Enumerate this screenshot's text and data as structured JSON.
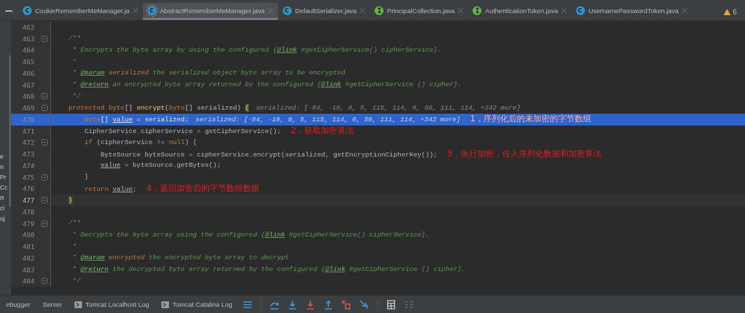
{
  "tabs": [
    {
      "label": "CookieRememberMeManager.ja",
      "kind": "class",
      "selected": false
    },
    {
      "label": "AbstractRememberMeManager.java",
      "kind": "abstract",
      "selected": true
    },
    {
      "label": "DefaultSerializer.java",
      "kind": "class",
      "selected": false
    },
    {
      "label": "PrincipalCollection.java",
      "kind": "interface",
      "selected": false
    },
    {
      "label": "AuthenticationToken.java",
      "kind": "interface",
      "selected": false
    },
    {
      "label": "UsernamePasswordToken.java",
      "kind": "class",
      "selected": false
    }
  ],
  "warnings": "6",
  "side_panel": [
    "e",
    "n",
    "Pr",
    "Cc",
    "rt",
    "ci",
    "oj"
  ],
  "lines": [
    {
      "number": "462",
      "selected": false,
      "caret": false
    },
    {
      "number": "463",
      "selected": false,
      "caret": false,
      "fold": true,
      "tokens": [
        {
          "text": "    /**",
          "kind": "comment"
        }
      ]
    },
    {
      "number": "464",
      "selected": false,
      "caret": false,
      "tokens": [
        {
          "text": "     * Encrypts the byte array by using the configured {",
          "kind": "comment"
        },
        {
          "text": "@link",
          "kind": "tag"
        },
        {
          "text": " #getCipherService() cipherService}.",
          "kind": "comment"
        }
      ]
    },
    {
      "number": "465",
      "selected": false,
      "caret": false,
      "tokens": [
        {
          "text": "     *",
          "kind": "comment"
        }
      ]
    },
    {
      "number": "466",
      "selected": false,
      "caret": false,
      "tokens": [
        {
          "text": "     * ",
          "kind": "comment"
        },
        {
          "text": "@param",
          "kind": "tag"
        },
        {
          "text": " serialized",
          "kind": "param"
        },
        {
          "text": " the serialized object byte array to be encrypted",
          "kind": "comment"
        }
      ]
    },
    {
      "number": "467",
      "selected": false,
      "caret": false,
      "tokens": [
        {
          "text": "     * ",
          "kind": "comment"
        },
        {
          "text": "@return",
          "kind": "tag"
        },
        {
          "text": " an encrypted byte array returned by the configured {",
          "kind": "comment"
        },
        {
          "text": "@link",
          "kind": "tag"
        },
        {
          "text": " #getCipherService () cipher}.",
          "kind": "comment"
        }
      ]
    },
    {
      "number": "468",
      "selected": false,
      "caret": false,
      "fold": true,
      "tokens": [
        {
          "text": "     */",
          "kind": "comment"
        }
      ]
    },
    {
      "number": "469",
      "selected": false,
      "caret": false,
      "fold": true,
      "tokens": [
        {
          "text": "    protected",
          "kind": "keyword"
        },
        {
          "text": " byte",
          "kind": "keyword"
        },
        {
          "text": "[] ",
          "kind": "plain"
        },
        {
          "text": "encrypt",
          "kind": "method"
        },
        {
          "text": "(",
          "kind": "plain"
        },
        {
          "text": "byte",
          "kind": "keyword"
        },
        {
          "text": "[] serialized) ",
          "kind": "plain"
        },
        {
          "text": "{",
          "kind": "brace"
        }
      ],
      "hint": "serialized: [-84, -19, 0, 5, 115, 114, 0, 50, 111, 114, +342 more]"
    },
    {
      "number": "470",
      "selected": true,
      "caret": false,
      "tokens": [
        {
          "text": "        byte",
          "kind": "keyword"
        },
        {
          "text": "[] ",
          "kind": "plain"
        },
        {
          "text": "value",
          "kind": "var"
        },
        {
          "text": " = serialized;",
          "kind": "plain"
        }
      ],
      "hint": "serialized: [-84, -19, 0, 5, 115, 114, 0, 50, 111, 114, +342 more]",
      "note": "1，序列化后的未加密的字节数组"
    },
    {
      "number": "471",
      "selected": false,
      "caret": false,
      "tokens": [
        {
          "text": "        CipherService cipherService = getCipherService();",
          "kind": "plain"
        }
      ],
      "note": "2，获取加密算法"
    },
    {
      "number": "472",
      "selected": false,
      "caret": false,
      "fold": true,
      "tokens": [
        {
          "text": "        if",
          "kind": "keyword"
        },
        {
          "text": " (cipherService != ",
          "kind": "plain"
        },
        {
          "text": "null",
          "kind": "keyword"
        },
        {
          "text": ") {",
          "kind": "plain"
        }
      ]
    },
    {
      "number": "473",
      "selected": false,
      "caret": false,
      "tokens": [
        {
          "text": "            ByteSource byteSource = cipherService.encrypt(serialized, getEncryptionCipherKey());",
          "kind": "plain"
        }
      ],
      "note": "3，执行加密，传入序列化数据和加密算法"
    },
    {
      "number": "474",
      "selected": false,
      "caret": false,
      "tokens": [
        {
          "text": "            value",
          "kind": "var"
        },
        {
          "text": " = byteSource.getBytes();",
          "kind": "plain"
        }
      ]
    },
    {
      "number": "475",
      "selected": false,
      "caret": false,
      "fold": true,
      "tokens": [
        {
          "text": "        }",
          "kind": "plain"
        }
      ]
    },
    {
      "number": "476",
      "selected": false,
      "caret": false,
      "tokens": [
        {
          "text": "        return",
          "kind": "keyword"
        },
        {
          "text": " value",
          "kind": "var"
        },
        {
          "text": ";",
          "kind": "plain"
        }
      ],
      "note": "4，返回加密后的字节数组数据"
    },
    {
      "number": "477",
      "selected": false,
      "caret": true,
      "fold": true,
      "tokens": [
        {
          "text": "    }",
          "kind": "brace"
        }
      ]
    },
    {
      "number": "478",
      "selected": false,
      "caret": false
    },
    {
      "number": "479",
      "selected": false,
      "caret": false,
      "fold": true,
      "tokens": [
        {
          "text": "    /**",
          "kind": "comment"
        }
      ]
    },
    {
      "number": "480",
      "selected": false,
      "caret": false,
      "tokens": [
        {
          "text": "     * Decrypts the byte array using the configured {",
          "kind": "comment"
        },
        {
          "text": "@link",
          "kind": "tag"
        },
        {
          "text": " #getCipherService() cipherService}.",
          "kind": "comment"
        }
      ]
    },
    {
      "number": "481",
      "selected": false,
      "caret": false,
      "tokens": [
        {
          "text": "     *",
          "kind": "comment"
        }
      ]
    },
    {
      "number": "482",
      "selected": false,
      "caret": false,
      "tokens": [
        {
          "text": "     * ",
          "kind": "comment"
        },
        {
          "text": "@param",
          "kind": "tag"
        },
        {
          "text": " encrypted",
          "kind": "param"
        },
        {
          "text": " the encrypted byte array to decrypt",
          "kind": "comment"
        }
      ]
    },
    {
      "number": "483",
      "selected": false,
      "caret": false,
      "tokens": [
        {
          "text": "     * ",
          "kind": "comment"
        },
        {
          "text": "@return",
          "kind": "tag"
        },
        {
          "text": " the decrypted byte array returned by the configured {",
          "kind": "comment"
        },
        {
          "text": "@link",
          "kind": "tag"
        },
        {
          "text": " #getCipherService () cipher}.",
          "kind": "comment"
        }
      ]
    },
    {
      "number": "484",
      "selected": false,
      "caret": false,
      "fold": true,
      "tokens": [
        {
          "text": "     */",
          "kind": "comment"
        }
      ]
    }
  ],
  "bottom_tabs": [
    {
      "label": "ebugger",
      "kind": "plain"
    },
    {
      "label": "Server",
      "kind": "plain"
    },
    {
      "label": "Tomcat Localhost Log",
      "kind": "console"
    },
    {
      "label": "Tomcat Catalina Log",
      "kind": "console"
    }
  ]
}
